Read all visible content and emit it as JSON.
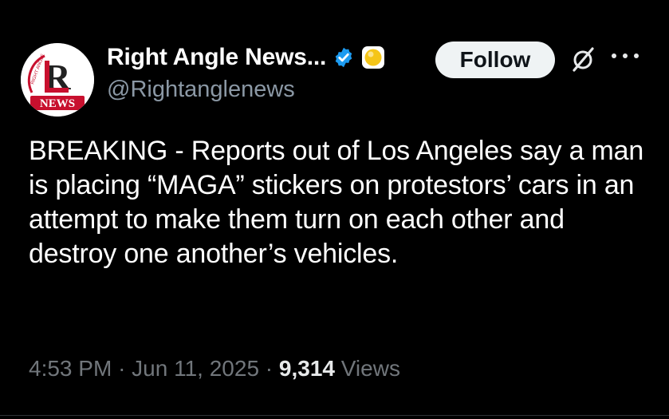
{
  "author": {
    "display_name": "Right Angle News...",
    "handle": "@Rightanglenews",
    "avatar_text_top": "RIGHT ANGLE",
    "avatar_letter": "R",
    "avatar_text_bottom": "NEWS",
    "verified_icon": "verified-badge-icon",
    "affiliate_icon": "gold-circle-badge-icon"
  },
  "actions": {
    "follow_label": "Follow",
    "grok_icon": "grok-icon",
    "more_icon": "more-options-icon"
  },
  "tweet": {
    "text": "BREAKING - Reports out of Los Angeles say a man is placing “MAGA” stickers on protestors’ cars in an attempt to make them turn on each other and destroy one another’s vehicles."
  },
  "meta": {
    "time": "4:53 PM",
    "separator": "·",
    "date": "Jun 11, 2025",
    "views_count": "9,314",
    "views_label": "Views"
  },
  "colors": {
    "background": "#000000",
    "text": "#ffffff",
    "secondary": "#8b98a5",
    "verified_blue": "#1d9bf0",
    "badge_gold": "#f5c518",
    "brand_red": "#c8102e",
    "follow_bg": "#eff3f4"
  }
}
